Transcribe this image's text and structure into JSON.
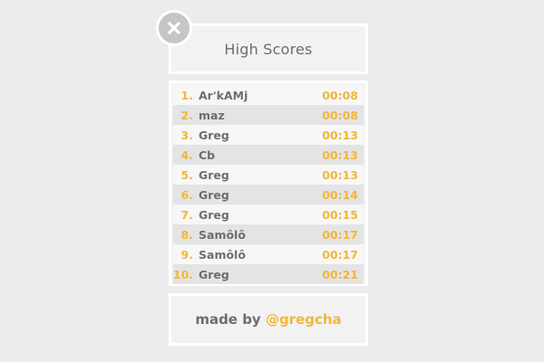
{
  "header": {
    "title": "High Scores",
    "close_icon": "close-x-icon"
  },
  "scores": [
    {
      "rank": "1.",
      "name": "Ar'kAMj",
      "time": "00:08"
    },
    {
      "rank": "2.",
      "name": "maz",
      "time": "00:08"
    },
    {
      "rank": "3.",
      "name": "Greg",
      "time": "00:13"
    },
    {
      "rank": "4.",
      "name": "Cb",
      "time": "00:13"
    },
    {
      "rank": "5.",
      "name": "Greg",
      "time": "00:13"
    },
    {
      "rank": "6.",
      "name": "Greg",
      "time": "00:14"
    },
    {
      "rank": "7.",
      "name": "Greg",
      "time": "00:15"
    },
    {
      "rank": "8.",
      "name": "Samôlô",
      "time": "00:17"
    },
    {
      "rank": "9.",
      "name": "Samôlô",
      "time": "00:17"
    },
    {
      "rank": "10.",
      "name": "Greg",
      "time": "00:21"
    }
  ],
  "footer": {
    "prefix": "made by ",
    "handle": "@gregcha"
  },
  "colors": {
    "accent": "#f2b63a",
    "text": "#6d6d6d",
    "background": "#ebeced",
    "panel": "#f2f2f2",
    "row_alt": "#e4e4e4"
  }
}
